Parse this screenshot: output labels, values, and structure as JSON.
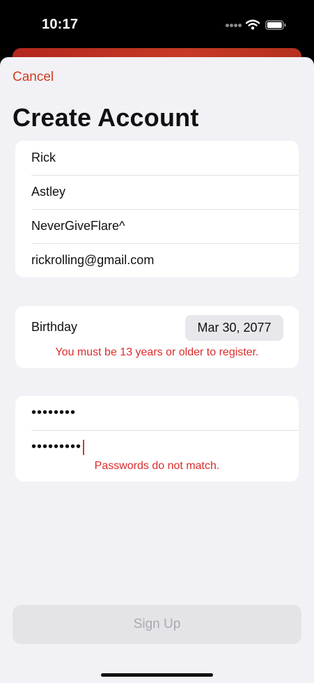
{
  "status_bar": {
    "time": "10:17",
    "icons": [
      "cellular-signal-icon",
      "wifi-icon",
      "battery-icon"
    ]
  },
  "nav": {
    "cancel_label": "Cancel",
    "title": "Create Account"
  },
  "account_fields": [
    {
      "name": "first-name-field",
      "value": "Rick"
    },
    {
      "name": "last-name-field",
      "value": "Astley"
    },
    {
      "name": "username-field",
      "value": "NeverGiveFlare^"
    },
    {
      "name": "email-field",
      "value": "rickrolling@gmail.com"
    }
  ],
  "birthday": {
    "label": "Birthday",
    "value": "Mar 30, 2077",
    "error": "You must be 13 years or older to register."
  },
  "passwords": {
    "password_masked": "••••••••",
    "confirm_masked": "•••••••••",
    "error": "Passwords do not match."
  },
  "signup": {
    "label": "Sign Up",
    "enabled": false
  },
  "colors": {
    "accent": "#cf3d1f",
    "error": "#dd2b2b",
    "background": "#f2f1f6",
    "disabled_button": "#e3e3e8",
    "disabled_text": "#a9a9ae"
  }
}
